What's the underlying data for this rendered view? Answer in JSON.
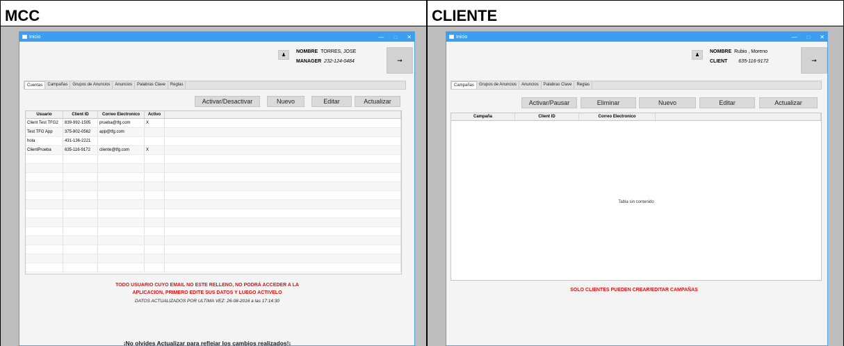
{
  "left": {
    "header": "MCC",
    "window_title": "Inicio",
    "user": {
      "nombre_label": "NOMBRE",
      "nombre_value": "TORRES, JOSE",
      "role_label": "MANAGER",
      "role_value": "232-124-0484"
    },
    "tabs": [
      "Cuentas",
      "Campañas",
      "Grupos de Anuncios",
      "Anuncios",
      "Palabras Clave",
      "Reglas"
    ],
    "buttons": [
      "Activar/Desactivar",
      "Nuevo",
      "Editar",
      "Actualizar"
    ],
    "columns": [
      "Usuario",
      "Client ID",
      "Correo Electronico",
      "Activo"
    ],
    "rows": [
      [
        "Client Test TFG2",
        "839-992-1505",
        "prueba@tfg.com",
        "X"
      ],
      [
        "Test TFG App",
        "375-802-0562",
        "app@tfg.com",
        ""
      ],
      [
        "hola",
        "431-136-2221",
        "",
        ""
      ],
      [
        "ClientPrueba",
        "635-116-9172",
        "cliente@tfg.com",
        "X"
      ]
    ],
    "warning": "TODO USUARIO CUYO EMAIL NO ESTE RELLENO, NO PODRÁ ACCEDER A LA APLICACION, PRIMERO EDITE SUS DATOS Y LUEGO ACTIVELO",
    "updated": "DATOS ACTUALIZADOS POR ULTIMA VEZ: 26-08-2016 a las 17:14:30",
    "reminder": "¡No olvides Actualizar para reflejar los cambios realizados!¡"
  },
  "right": {
    "header": "CLIENTE",
    "window_title": "Inicio",
    "user": {
      "nombre_label": "NOMBRE",
      "nombre_value": "Rubio , Moreno",
      "role_label": "CLIENT",
      "role_value": "635-116-9172"
    },
    "tabs": [
      "Campañas",
      "Grupos de Anuncios",
      "Anuncios",
      "Palabras Clave",
      "Reglas"
    ],
    "buttons": [
      "Activar/Pausar",
      "Eliminar",
      "Nuevo",
      "Editar",
      "Actualizar"
    ],
    "columns": [
      "Campaña",
      "Client ID",
      "Correo Electronico"
    ],
    "empty_text": "Tabla sin contenido",
    "warning": "SOLO CLIENTES PUEDEN CREAR/EDITAR CAMPAÑAS"
  },
  "icons": {
    "user": "user-icon",
    "logout": "logout-icon"
  }
}
